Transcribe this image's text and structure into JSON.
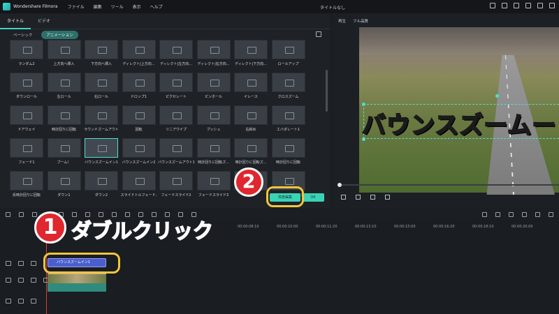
{
  "app": {
    "name": "Wondershare Filmora",
    "doc_title": "タイトルなし"
  },
  "menu": [
    "ファイル",
    "編集",
    "ツール",
    "表示",
    "ヘルプ"
  ],
  "panel": {
    "tabs": [
      "タイトル",
      "ビデオ"
    ],
    "subtabs": [
      "ベーシック",
      "アニメーション"
    ],
    "rows": [
      [
        "ランダム2",
        "上方向へ挿入",
        "下方向へ挿入",
        "ディレクト|上方向...",
        "ディレクト|左方向...",
        "ディレクト|右方向...",
        "ディレクト|下方向...",
        "ロールアップ"
      ],
      [
        "ダウンロール",
        "左ロール",
        "右ロール",
        "ドロップ1",
        "ピクセレート",
        "ピンホール",
        "イレース",
        "クロスズーム"
      ],
      [
        "ドアウェイ",
        "時計回りに回転",
        "ラウンドズームアウト",
        "回転",
        "リニアワイプ",
        "プッシュ",
        "右斜め",
        "エバポレート1"
      ],
      [
        "フェード1",
        "ブーム！",
        "バウンスズームイン1",
        "バウンスズームイン2",
        "バウンスズームアウト1",
        "時計回りに回転ズ...",
        "時計回りに回転ズ...",
        "時計回りに回転"
      ],
      [
        "反時計回りに回転",
        "ダウン1",
        "ダウン2",
        "スライドトルフェード...",
        "フェードスライド2",
        "フェードスライド3",
        "",
        "フェードズームイン"
      ]
    ],
    "selected": "バウンスズームイン1",
    "advanced_button": "高度編集",
    "ok_button": "OK"
  },
  "preview": {
    "play_label": "再生",
    "quality": "フル品質",
    "overlay_text_main": "バウンスズーム",
    "overlay_text_tail": "ー"
  },
  "timeline": {
    "ticks": [
      "00:00:08:10",
      "00:00:10:00",
      "00:00:11:20",
      "00:00:13:10",
      "00:00:15:00",
      "00:00:16:20",
      "00:00:18:10",
      "00:00:20:00"
    ],
    "title_clip": "バウンスズームイン1"
  },
  "annotations": {
    "step1_num": "1",
    "step1_text": "ダブルクリック",
    "step2_num": "2"
  },
  "colors": {
    "accent": "#3bd3b6",
    "highlight": "#f2c53b",
    "badge": "#e0262e",
    "title_clip": "#4b5fcc"
  }
}
